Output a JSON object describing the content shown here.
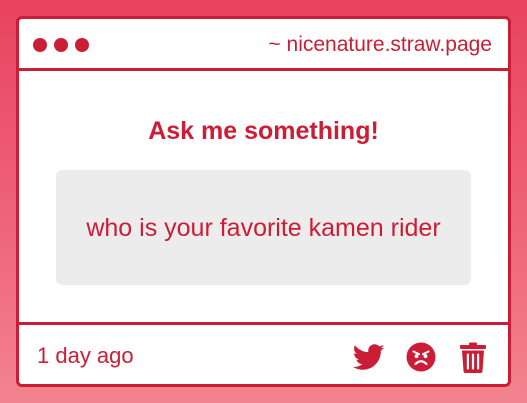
{
  "window": {
    "url": "~ nicenature.straw.page",
    "controls": [
      "dot-1",
      "dot-2",
      "dot-3"
    ]
  },
  "main": {
    "heading": "Ask me something!",
    "question": "who is your favorite kamen rider"
  },
  "footer": {
    "timestamp": "1 day ago",
    "actions": [
      {
        "icon": "twitter-icon",
        "label": "share on twitter"
      },
      {
        "icon": "angry-face-icon",
        "label": "report"
      },
      {
        "icon": "trash-icon",
        "label": "delete"
      }
    ]
  },
  "colors": {
    "accent": "#cc1d36",
    "background_top": "#e8435f",
    "background_bottom": "#f2848f",
    "card": "#ffffff",
    "question_box": "#edeced"
  }
}
